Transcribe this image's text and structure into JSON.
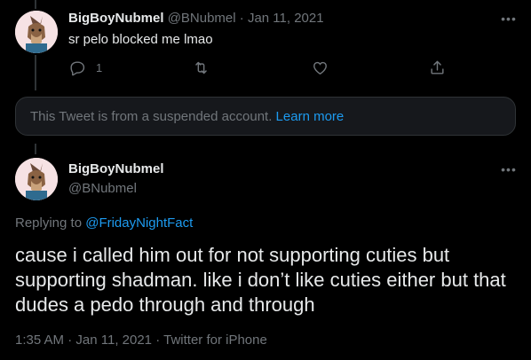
{
  "tweet1": {
    "name": "BigBoyNubmel",
    "handle": "@BNubmel",
    "separator": "·",
    "date": "Jan 11, 2021",
    "text": "sr pelo blocked me lmao",
    "reply_count": "1",
    "icons": [
      "reply-icon",
      "retweet-icon",
      "like-icon",
      "share-icon",
      "more-icon"
    ]
  },
  "suspended": {
    "text": "This Tweet is from a suspended account.",
    "link": "Learn more"
  },
  "tweet2": {
    "name": "BigBoyNubmel",
    "handle": "@BNubmel",
    "replying_prefix": "Replying to ",
    "replying_to": "@FridayNightFact",
    "text": "cause i called him out for not supporting cuties but supporting shadman. like i don’t like cuties either but that dudes a pedo through and through",
    "time": "1:35 AM",
    "separator": "·",
    "date": "Jan 11, 2021",
    "source": "Twitter for iPhone"
  },
  "colors": {
    "background": "#000000",
    "text": "#e7e9ea",
    "muted": "#71767b",
    "link": "#1d9bf0",
    "border": "#2f3336"
  }
}
